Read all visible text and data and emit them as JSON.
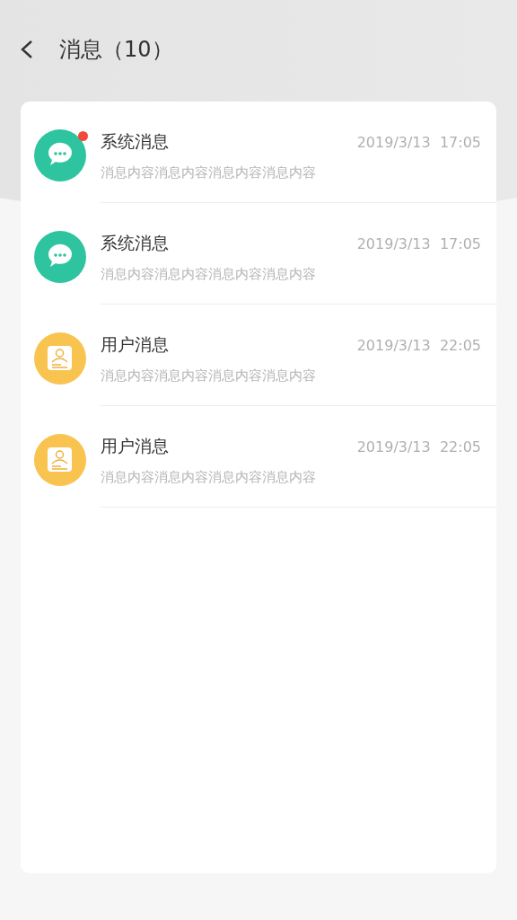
{
  "header": {
    "title": "消息（10）"
  },
  "messages": [
    {
      "kind": "system",
      "unread": true,
      "title": "系统消息",
      "time": "2019/3/13  17:05",
      "preview": "消息内容消息内容消息内容消息内容"
    },
    {
      "kind": "system",
      "unread": false,
      "title": "系统消息",
      "time": "2019/3/13  17:05",
      "preview": "消息内容消息内容消息内容消息内容"
    },
    {
      "kind": "user",
      "unread": false,
      "title": "用户消息",
      "time": "2019/3/13  22:05",
      "preview": "消息内容消息内容消息内容消息内容"
    },
    {
      "kind": "user",
      "unread": false,
      "title": "用户消息",
      "time": "2019/3/13  22:05",
      "preview": "消息内容消息内容消息内容消息内容"
    }
  ]
}
